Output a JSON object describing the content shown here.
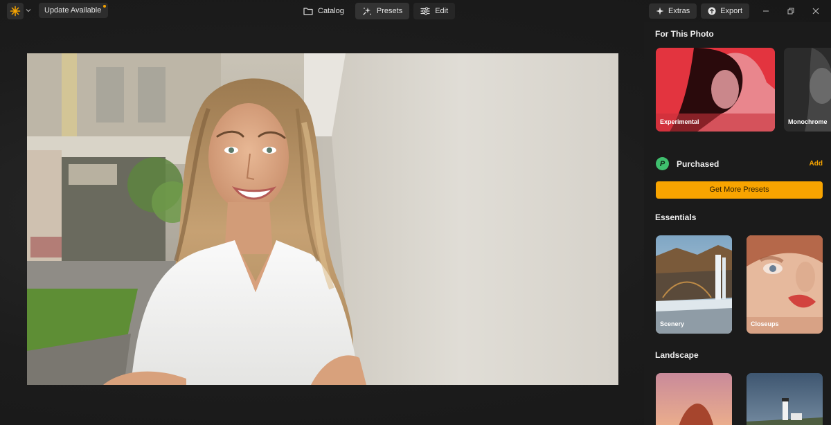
{
  "topbar": {
    "update_label": "Update Available",
    "nav": [
      {
        "label": "Catalog",
        "icon": "folder-icon"
      },
      {
        "label": "Presets",
        "icon": "sparkle-icon",
        "active": true
      },
      {
        "label": "Edit",
        "icon": "sliders-icon"
      }
    ],
    "extras_label": "Extras",
    "export_label": "Export",
    "accent_color": "#f5a300"
  },
  "panel": {
    "for_this_photo": {
      "title": "For This Photo",
      "cards": [
        "Experimental",
        "Monochrome"
      ]
    },
    "purchased": {
      "icon_letter": "P",
      "label": "Purchased",
      "add_label": "Add"
    },
    "get_more_label": "Get More Presets",
    "essentials": {
      "title": "Essentials",
      "cards": [
        "Scenery",
        "Closeups"
      ]
    },
    "landscape": {
      "title": "Landscape"
    }
  }
}
